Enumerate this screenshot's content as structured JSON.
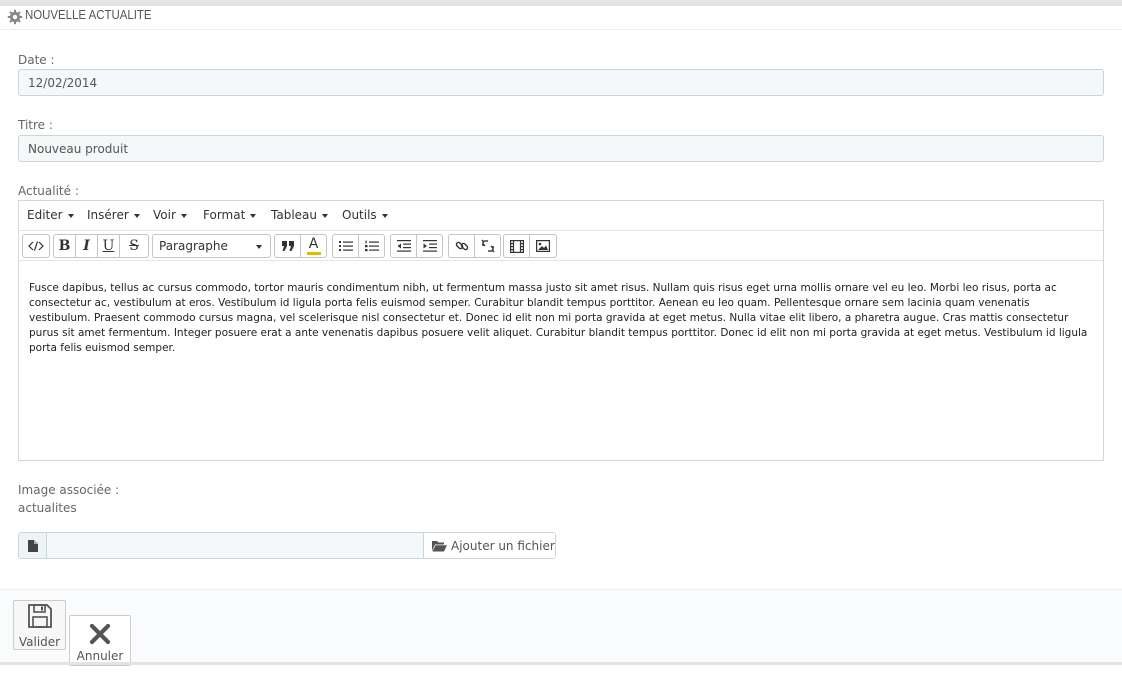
{
  "panel": {
    "title": "NOUVELLE ACTUALITE",
    "icon": "gear-icon"
  },
  "form": {
    "date_label": "Date :",
    "date_value": "12/02/2014",
    "title_label": "Titre :",
    "title_value": "Nouveau produit",
    "news_label": "Actualité :",
    "image_label": "Image associée :",
    "image_folder": "actualites"
  },
  "editor": {
    "menus": [
      "Editer",
      "Insérer",
      "Voir",
      "Format",
      "Tableau",
      "Outils"
    ],
    "format_select": "Paragraphe",
    "toolbar_icons": [
      "code-icon",
      "bold-icon",
      "italic-icon",
      "underline-icon",
      "strikethrough-icon",
      "blockquote-icon",
      "text-color-icon",
      "bullet-list-icon",
      "numbered-list-icon",
      "outdent-icon",
      "indent-icon",
      "link-icon",
      "unlink-icon",
      "media-icon",
      "image-icon"
    ],
    "bold": "B",
    "italic": "I",
    "underline": "U",
    "strike": "S",
    "text_color": "A",
    "content": "Fusce dapibus, tellus ac cursus commodo, tortor mauris condimentum nibh, ut fermentum massa justo sit amet risus. Nullam quis risus eget urna mollis ornare vel eu leo. Morbi leo risus, porta ac consectetur ac, vestibulum at eros. Vestibulum id ligula porta felis euismod semper. Curabitur blandit tempus porttitor. Aenean eu leo quam. Pellentesque ornare sem lacinia quam venenatis vestibulum. Praesent commodo cursus magna, vel scelerisque nisl consectetur et. Donec id elit non mi porta gravida at eget metus. Nulla vitae elit libero, a pharetra augue. Cras mattis consectetur purus sit amet fermentum. Integer posuere erat a ante venenatis dapibus posuere velit aliquet. Curabitur blandit tempus porttitor. Donec id elit non mi porta gravida at eget metus. Vestibulum id ligula porta felis euismod semper."
  },
  "file": {
    "button_label": "Ajouter un fichier",
    "value": ""
  },
  "footer": {
    "save_label": "Valider",
    "cancel_label": "Annuler"
  }
}
